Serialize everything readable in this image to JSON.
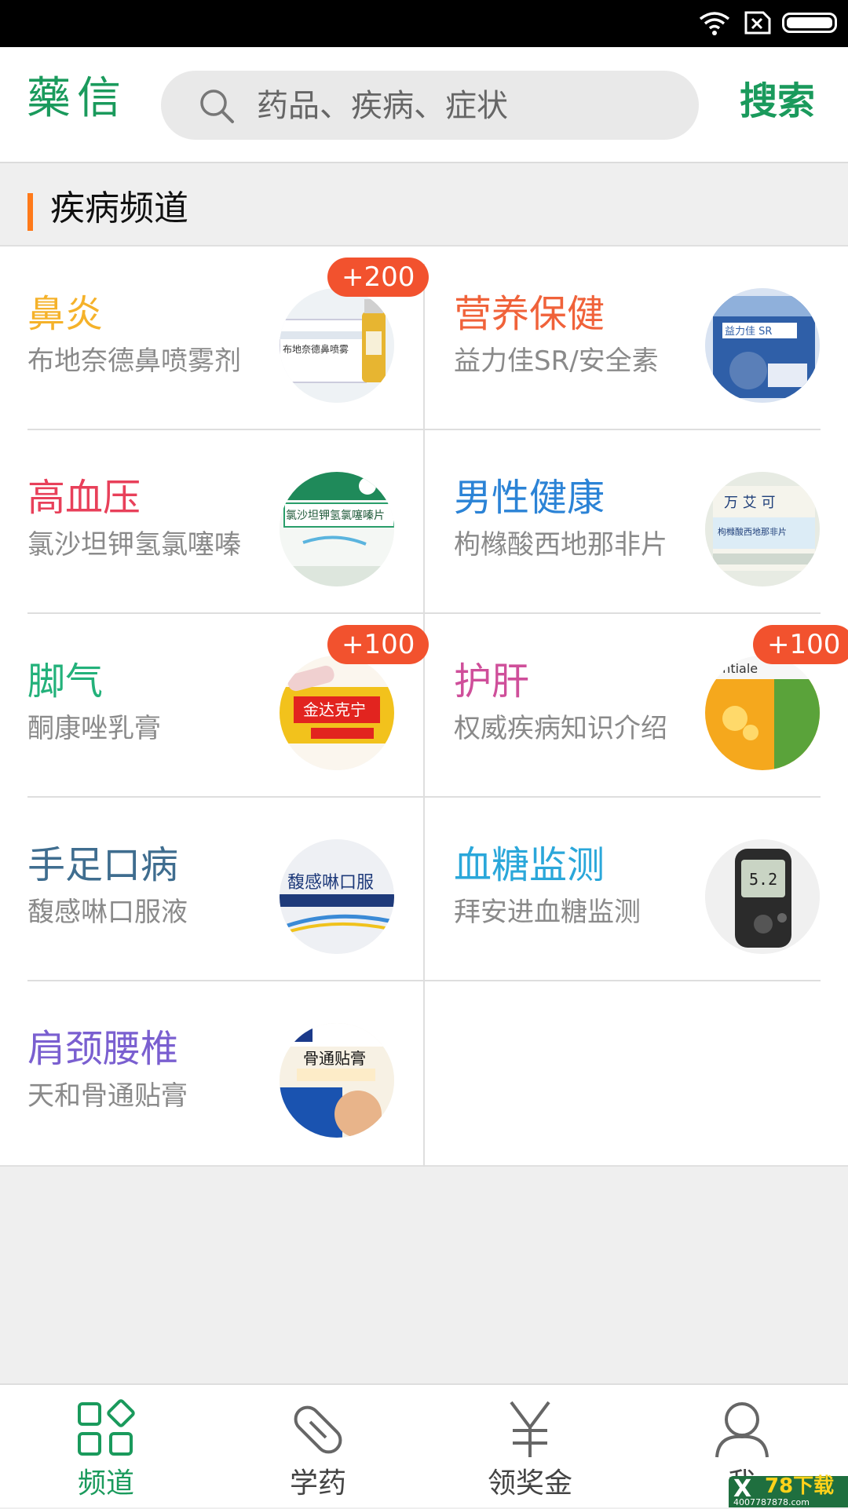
{
  "header": {
    "logo": "藥信",
    "search_placeholder": "药品、疾病、症状",
    "search_button": "搜索"
  },
  "section": {
    "title": "疾病频道"
  },
  "colors": {
    "brand_green": "#1a9a5c",
    "accent_orange": "#ff7a1a",
    "badge_red": "#f2522e"
  },
  "channels": [
    {
      "name": "鼻炎",
      "sub": "布地奈德鼻喷雾剂",
      "color": "#f5b22a",
      "badge": "+200",
      "thumb": "nasal-spray-image"
    },
    {
      "name": "营养保健",
      "sub": "益力佳SR/安全素",
      "color": "#f0623a",
      "badge": "",
      "thumb": "glucerna-box-image"
    },
    {
      "name": "高血压",
      "sub": "氯沙坦钾氢氯噻嗪",
      "color": "#e8405a",
      "badge": "",
      "thumb": "losartan-box-image"
    },
    {
      "name": "男性健康",
      "sub": "枸橼酸西地那非片",
      "color": "#2b83d6",
      "badge": "",
      "thumb": "sildenafil-box-image"
    },
    {
      "name": "脚气",
      "sub": "酮康唑乳膏",
      "color": "#23b17a",
      "badge": "+100",
      "thumb": "ketoconazole-cream-image"
    },
    {
      "name": "护肝",
      "sub": "权威疾病知识介绍",
      "color": "#cf4f9a",
      "badge": "+100",
      "thumb": "essentiale-box-image"
    },
    {
      "name": "手足口病",
      "sub": "馥感啉口服液",
      "color": "#3f6d8f",
      "badge": "",
      "thumb": "fuganlin-box-image"
    },
    {
      "name": "血糖监测",
      "sub": "拜安进血糖监测",
      "color": "#2aa7da",
      "badge": "",
      "thumb": "glucose-meter-image"
    },
    {
      "name": "肩颈腰椎",
      "sub": "天和骨通贴膏",
      "color": "#7a5fd0",
      "badge": "",
      "thumb": "plaster-box-image"
    }
  ],
  "nav": [
    {
      "label": "频道",
      "icon": "grid-icon",
      "active": true
    },
    {
      "label": "学药",
      "icon": "pill-icon",
      "active": false
    },
    {
      "label": "领奖金",
      "icon": "yen-icon",
      "active": false
    },
    {
      "label": "我",
      "icon": "user-icon",
      "active": false
    }
  ],
  "watermark": {
    "brand": "78下载",
    "url": "4007787878.com"
  }
}
